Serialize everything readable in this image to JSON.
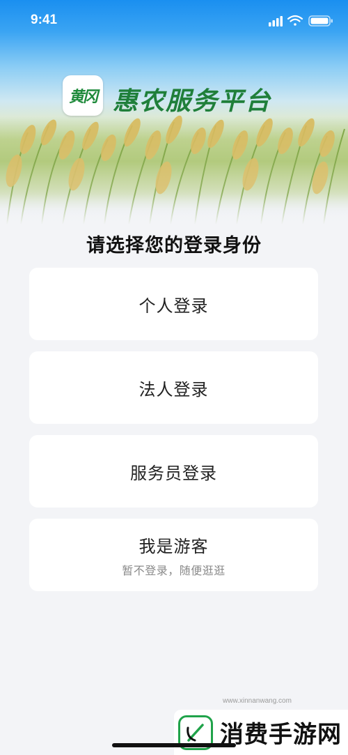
{
  "status_bar": {
    "time": "9:41",
    "icons": [
      "signal-icon",
      "wifi-icon",
      "battery-icon"
    ]
  },
  "header": {
    "logo_tile_text": "黄冈",
    "title": "惠农服务平台"
  },
  "main": {
    "heading": "请选择您的登录身份",
    "options": [
      {
        "label": "个人登录",
        "sublabel": ""
      },
      {
        "label": "法人登录",
        "sublabel": ""
      },
      {
        "label": "服务员登录",
        "sublabel": ""
      },
      {
        "label": "我是游客",
        "sublabel": "暂不登录，随便逛逛"
      }
    ]
  },
  "watermark": {
    "text": "消费手游网",
    "url": "www.xinnanwang.com"
  },
  "colors": {
    "page_bg": "#f3f4f7",
    "card_bg": "#ffffff",
    "brand_green": "#1f7f3a",
    "sky_blue": "#1a8ff0"
  }
}
